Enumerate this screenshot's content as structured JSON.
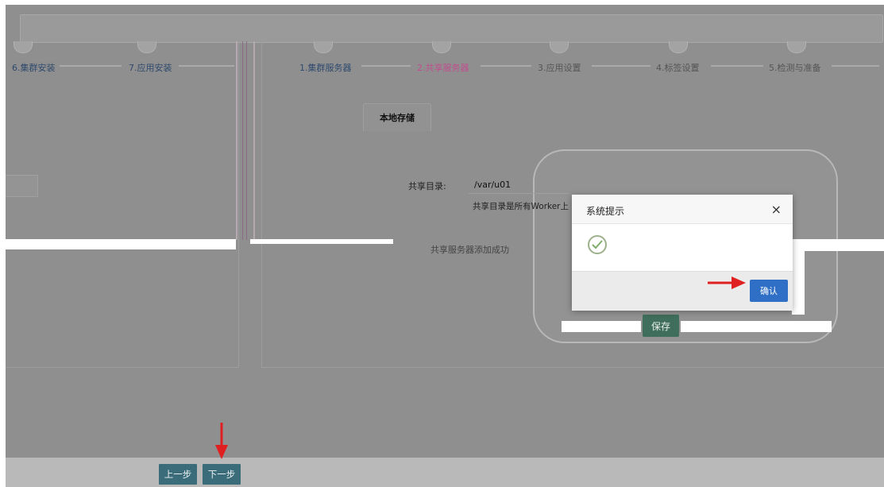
{
  "left_steps": [
    {
      "label": "6.集群安装"
    },
    {
      "label": "7.应用安装"
    }
  ],
  "right_steps": [
    {
      "label": "1.集群服务器",
      "state": "done"
    },
    {
      "label": "2.共享服务器",
      "state": "active"
    },
    {
      "label": "3.应用设置",
      "state": "todo"
    },
    {
      "label": "4.标签设置",
      "state": "todo"
    },
    {
      "label": "5.检测与准备",
      "state": "todo"
    }
  ],
  "tab": {
    "label": "本地存储"
  },
  "share": {
    "label": "共享目录:",
    "value": "/var/u01",
    "hint": "共享目录是所有Worker上"
  },
  "info_text": "共享服务器添加成功",
  "save_label": "保存",
  "dialog": {
    "title": "系统提示",
    "close_glyph": "×",
    "message": "",
    "confirm_label": "确认"
  },
  "nav": {
    "prev_label": "上一步",
    "next_label": "下一步"
  },
  "colors": {
    "active_step": "#c04d8d",
    "step": "#2f4a6d",
    "confirm": "#2f6fc6",
    "nav_button": "#3b6c79",
    "save_button": "#3f6e5c",
    "annotation_arrow": "#e02020"
  }
}
